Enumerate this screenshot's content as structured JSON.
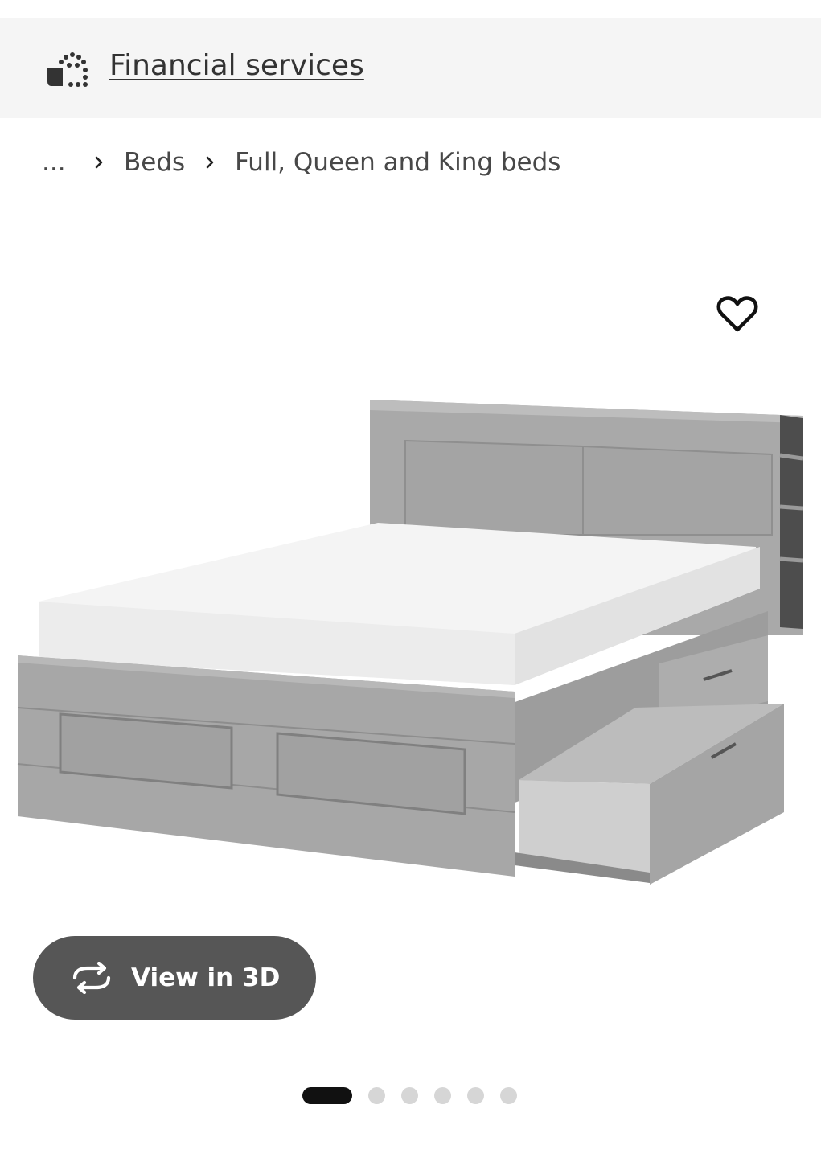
{
  "banner": {
    "link_label": "Financial services",
    "icon": "financial-services-icon"
  },
  "breadcrumb": {
    "ellipsis": "...",
    "items": [
      "Beds",
      "Full, Queen and King beds"
    ]
  },
  "product": {
    "image_alt_icon": "bed-frame-illustration",
    "favorite_icon": "heart-icon"
  },
  "view3d": {
    "label": "View in 3D",
    "icon": "rotate-3d-icon"
  },
  "carousel": {
    "total": 6,
    "active_index": 0
  },
  "colors": {
    "banner_bg": "#f5f5f5",
    "button_bg": "#565656",
    "dot_active": "#111111",
    "dot_inactive": "#d6d6d6"
  }
}
